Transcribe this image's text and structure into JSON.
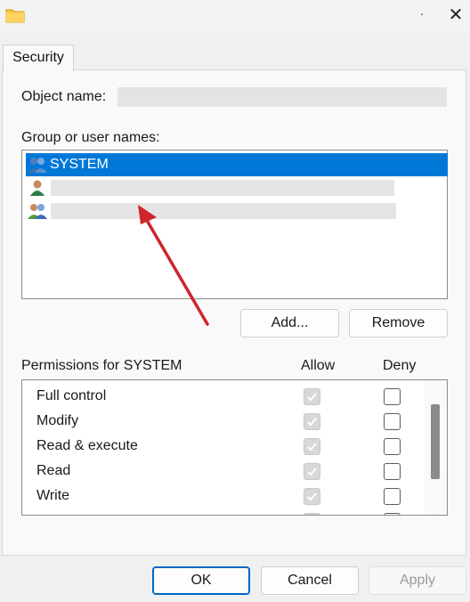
{
  "window": {
    "title_mark": ".",
    "close_glyph": "✕"
  },
  "tabs": [
    {
      "label": "Security"
    }
  ],
  "object_name": {
    "label": "Object name:"
  },
  "group": {
    "label": "Group or user names:",
    "users": [
      {
        "name": "SYSTEM",
        "selected": true,
        "icon": "users-group-icon"
      },
      {
        "name": "",
        "selected": false,
        "icon": "user-icon",
        "visible_mark": "( )"
      },
      {
        "name": "",
        "selected": false,
        "icon": "users-group-icon",
        "visible_mark": ")"
      }
    ]
  },
  "buttons": {
    "add": "Add...",
    "remove": "Remove",
    "ok": "OK",
    "cancel": "Cancel",
    "apply": "Apply"
  },
  "permissions": {
    "label": "Permissions for SYSTEM",
    "allow_header": "Allow",
    "deny_header": "Deny",
    "rows": [
      {
        "name": "Full control",
        "allow": true,
        "deny": false
      },
      {
        "name": "Modify",
        "allow": true,
        "deny": false
      },
      {
        "name": "Read & execute",
        "allow": true,
        "deny": false
      },
      {
        "name": "Read",
        "allow": true,
        "deny": false
      },
      {
        "name": "Write",
        "allow": true,
        "deny": false
      }
    ]
  },
  "colors": {
    "accent": "#0078d7",
    "annotation_arrow": "#d0242b"
  }
}
